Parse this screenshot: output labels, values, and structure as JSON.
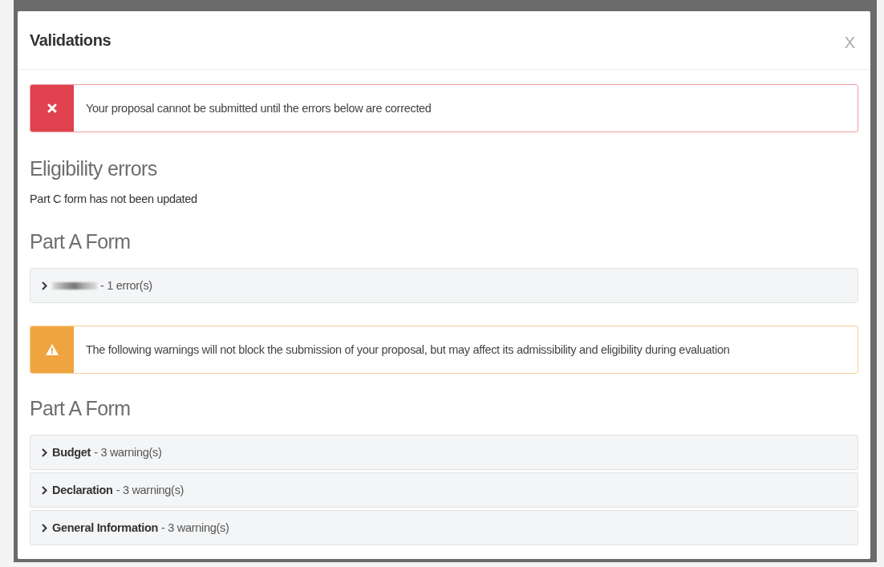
{
  "dialog": {
    "title": "Validations",
    "close_label": "X"
  },
  "error_alert": {
    "message": "Your proposal cannot be submitted until the errors below are corrected"
  },
  "eligibility": {
    "heading": "Eligibility errors",
    "items": [
      "Part C form has not been updated"
    ]
  },
  "error_sections": [
    {
      "heading": "Part A Form",
      "items": [
        {
          "name_redacted": true,
          "count": "- 1 error(s)",
          "expanded": false
        }
      ]
    }
  ],
  "warning_alert": {
    "message": "The following warnings will not block the submission of your proposal, but may affect its admissibility and eligibility during evaluation"
  },
  "warning_sections": [
    {
      "heading": "Part A Form",
      "items": [
        {
          "name_redacted": false,
          "name": "Budget",
          "count": "- 3 warning(s)",
          "expanded": false
        },
        {
          "name_redacted": false,
          "name": "Declaration",
          "count": "- 3 warning(s)",
          "expanded": false
        },
        {
          "name_redacted": false,
          "name": "General Information",
          "count": "- 3 warning(s)",
          "expanded": false
        }
      ]
    }
  ]
}
